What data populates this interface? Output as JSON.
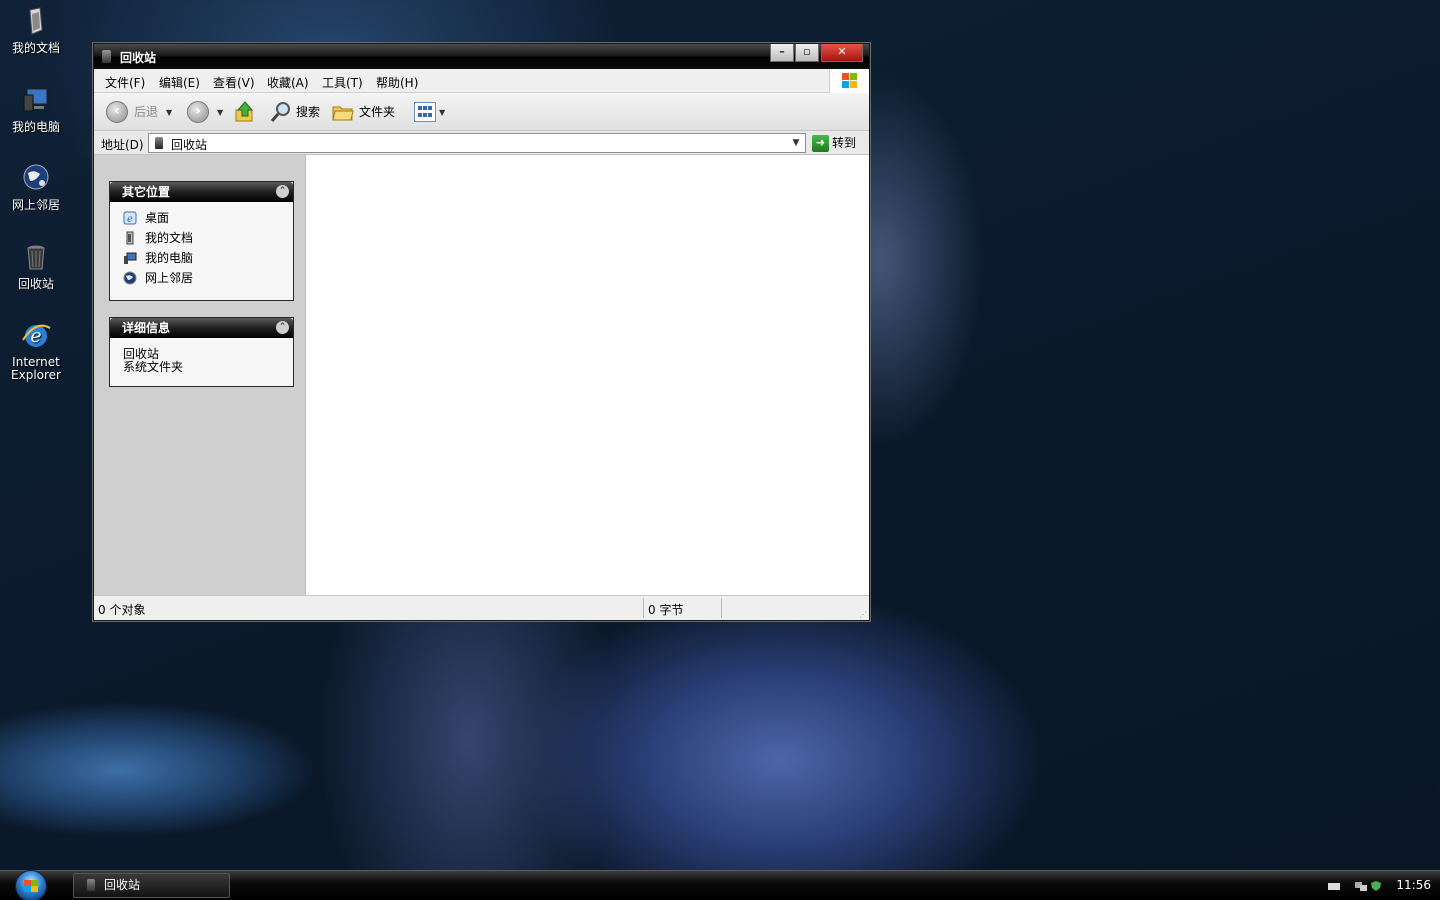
{
  "desktop": {
    "icons": [
      {
        "label": "我的文档"
      },
      {
        "label": "我的电脑"
      },
      {
        "label": "网上邻居"
      },
      {
        "label": "回收站"
      },
      {
        "label": "Internet Explorer"
      }
    ]
  },
  "window": {
    "title": "回收站",
    "minimize": "–",
    "maximize": "▫",
    "close": "✕",
    "menu": [
      "文件(F)",
      "编辑(E)",
      "查看(V)",
      "收藏(A)",
      "工具(T)",
      "帮助(H)"
    ],
    "toolbar": {
      "back": "后退",
      "search": "搜索",
      "folders": "文件夹"
    },
    "address": {
      "label": "地址(D)",
      "value": "回收站",
      "go": "转到"
    },
    "other_places": {
      "title": "其它位置",
      "items": [
        "桌面",
        "我的文档",
        "我的电脑",
        "网上邻居"
      ]
    },
    "details": {
      "title": "详细信息",
      "name": "回收站",
      "type": "系统文件夹"
    },
    "status": {
      "objects": "0 个对象",
      "size": "0 字节"
    }
  },
  "taskbar": {
    "task": "回收站",
    "clock": "11:56"
  },
  "colors": {
    "title_bar": "#000000",
    "close_button": "#c4281e",
    "go_arrow": "#2e9a2e"
  }
}
